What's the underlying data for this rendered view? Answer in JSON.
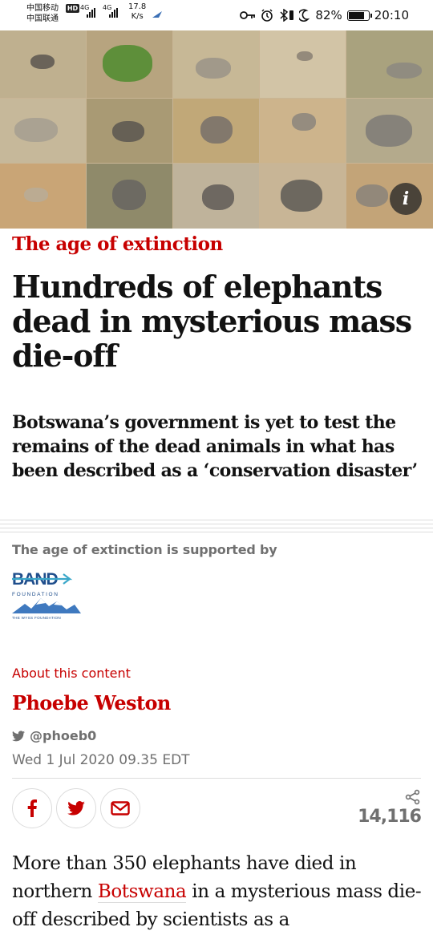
{
  "status_bar": {
    "carrier_1": "中国移动",
    "carrier_2": "中国联通",
    "hd": "HD",
    "net_1": "4G",
    "net_2": "4G",
    "speed_value": "17.8",
    "speed_unit": "K/s",
    "battery": "82%",
    "battery_level": 0.82,
    "time": "20:10"
  },
  "hero": {
    "info_label": "i"
  },
  "article": {
    "series": "The age of extinction",
    "headline": "Hundreds of elephants dead in mysterious mass die-off",
    "standfirst": "Botswana’s government is yet to test the remains of the dead animals in what has been described as a ‘conservation disaster’",
    "supported_by": "The age of extinction is supported by",
    "sponsor_logo": {
      "name": "BAND",
      "sub": "FOUNDATION",
      "caption": "THE WYSS FOUNDATION"
    },
    "about_link": "About this content",
    "byline": "Phoebe Weston",
    "twitter_handle": "@phoeb0",
    "date": "Wed 1 Jul 2020 09.35 EDT",
    "share_count": "14,116",
    "body": {
      "before_link": "More than 350 elephants have died in northern ",
      "link": "Botswana",
      "after_link": " in a mysterious mass die-off described by scientists as a"
    }
  },
  "colors": {
    "accent": "#c70000",
    "muted": "#707070",
    "text": "#121212",
    "rule": "#dcdcdc"
  },
  "icons": [
    "facebook-icon",
    "twitter-icon",
    "email-icon",
    "share-icon",
    "twitter-bird-icon",
    "info-icon",
    "alarm-icon",
    "bluetooth-icon",
    "moon-icon",
    "key-icon"
  ]
}
